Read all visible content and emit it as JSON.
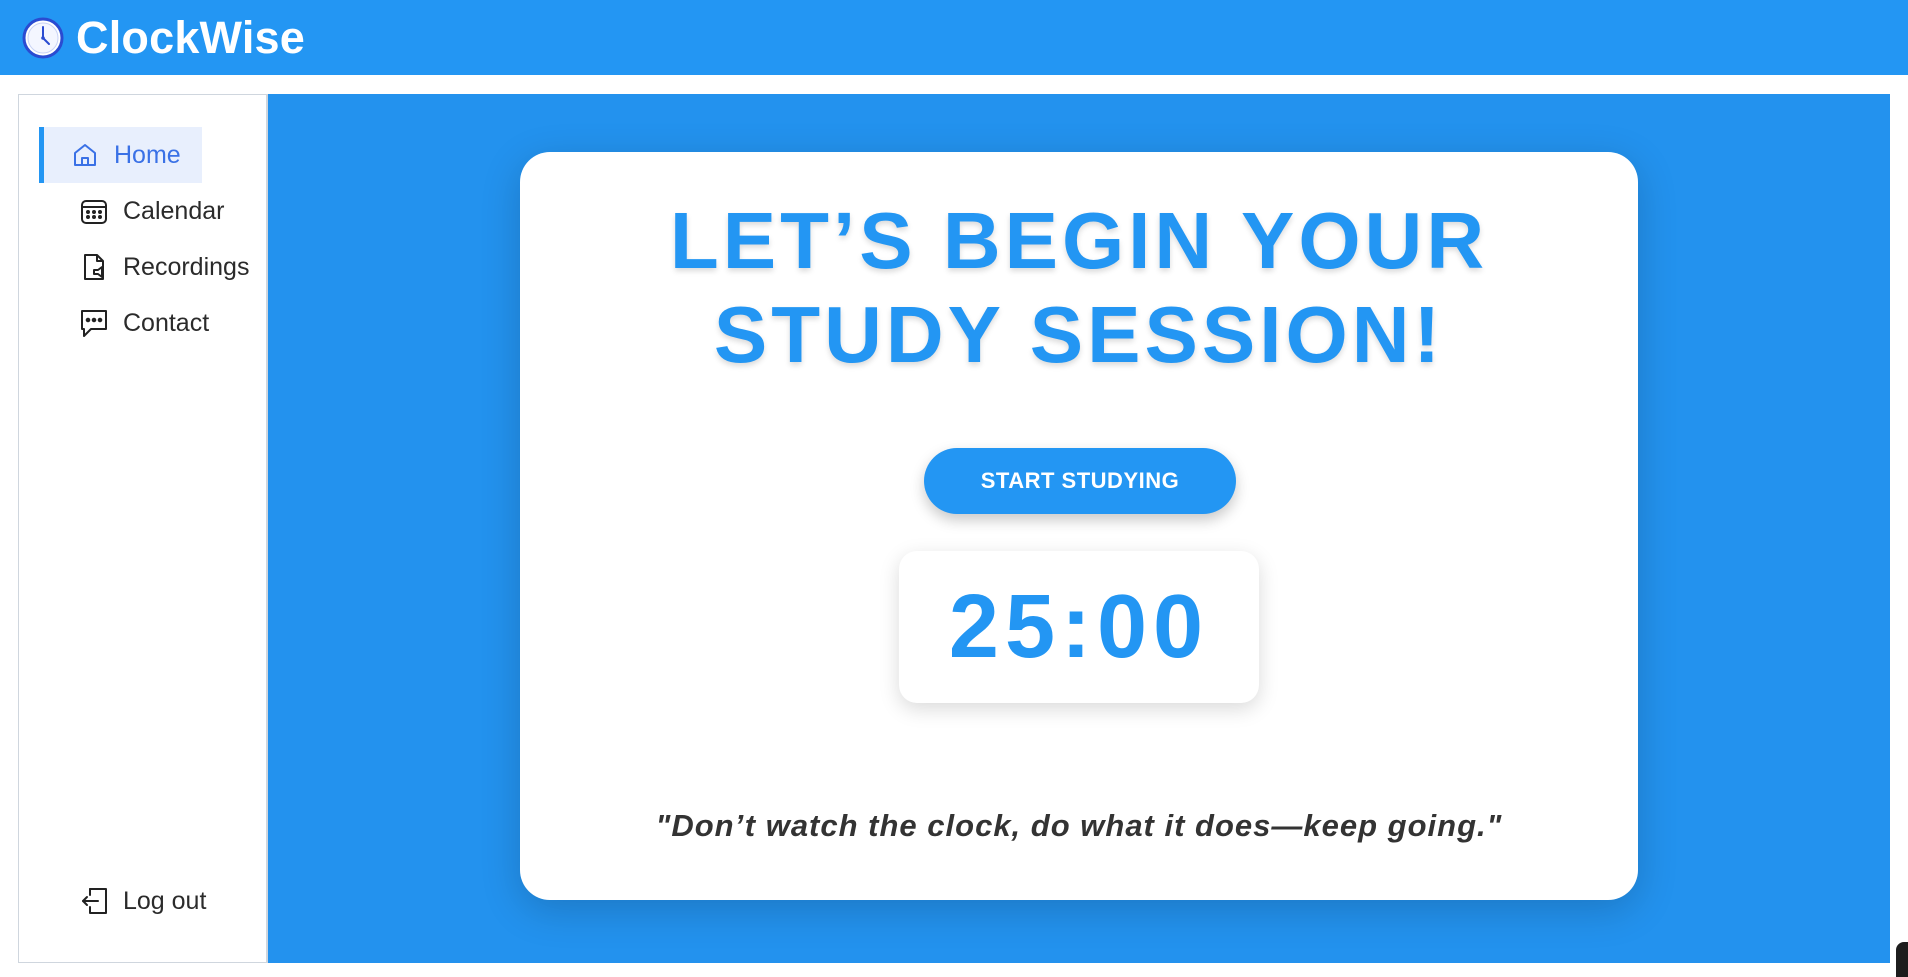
{
  "app": {
    "title": "ClockWise",
    "logo_icon": "clock-icon"
  },
  "sidebar": {
    "items": [
      {
        "label": "Home",
        "icon": "home-icon",
        "active": true
      },
      {
        "label": "Calendar",
        "icon": "calendar-icon",
        "active": false
      },
      {
        "label": "Recordings",
        "icon": "recording-file-icon",
        "active": false
      },
      {
        "label": "Contact",
        "icon": "chat-icon",
        "active": false
      }
    ],
    "logout": {
      "label": "Log out",
      "icon": "logout-icon"
    }
  },
  "main": {
    "headline_line1": "LET’S BEGIN YOUR",
    "headline_line2": "STUDY SESSION!",
    "start_button": "START STUDYING",
    "timer": "25:00",
    "quote": "\"Don’t watch the clock, do what it does—keep going.\""
  },
  "colors": {
    "brand_blue": "#2396f3",
    "active_nav_bg": "#e8effd",
    "active_nav_text": "#3a71e6",
    "text_dark": "#333333"
  }
}
